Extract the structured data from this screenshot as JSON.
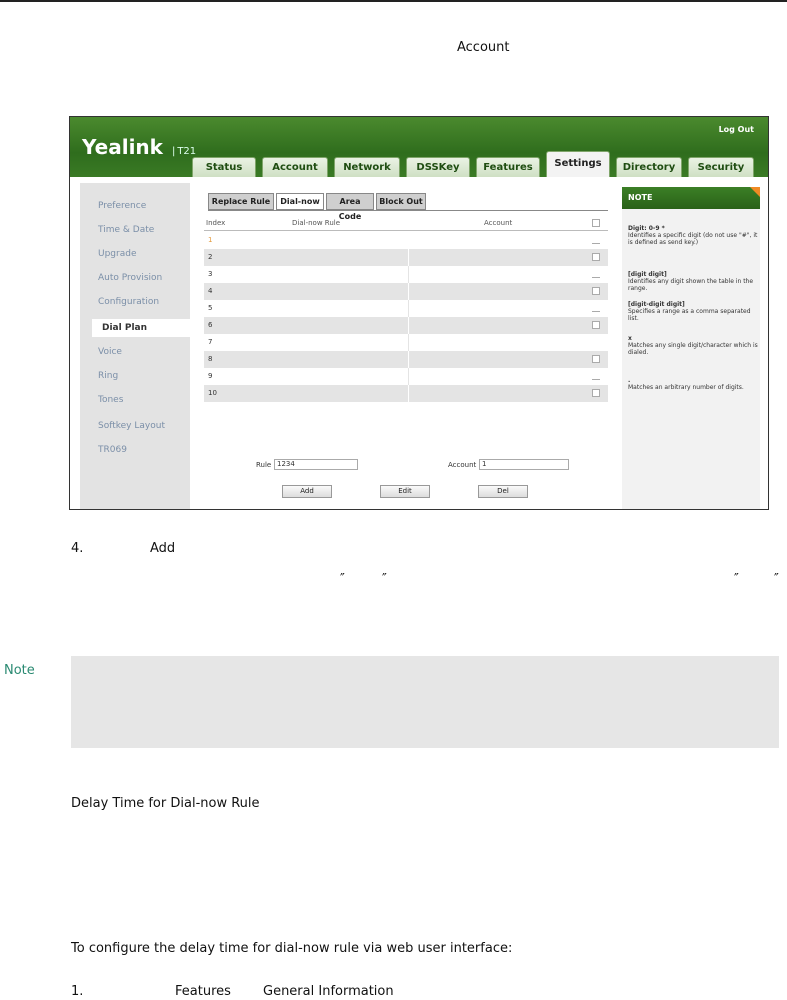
{
  "doc": {
    "account_label": "Account",
    "step4_number": "4.",
    "step4_word": "Add",
    "quote_mark": "″",
    "note_label": "Note",
    "section_heading": "Delay Time for Dial-now Rule",
    "procedure_heading": "To configure the delay time for dial-now rule via web user interface:",
    "step1_number": "1.",
    "step1_path1": "Features",
    "step1_path2": "General Information"
  },
  "webui": {
    "logo": "Yealink",
    "model": "T21",
    "logout": "Log Out",
    "nav_tabs": [
      "Status",
      "Account",
      "Network",
      "DSSKey",
      "Features",
      "Settings",
      "Directory",
      "Security"
    ],
    "active_nav": "Settings",
    "sidebar": [
      "Preference",
      "Time & Date",
      "Upgrade",
      "Auto Provision",
      "Configuration",
      "Dial Plan",
      "Voice",
      "Ring",
      "Tones",
      "Softkey Layout",
      "TR069"
    ],
    "active_sidebar": "Dial Plan",
    "subtabs": [
      "Replace Rule",
      "Dial-now",
      "Area Code",
      "Block Out"
    ],
    "active_subtab": "Dial-now",
    "table": {
      "col_index": "Index",
      "col_rule": "Dial-now Rule",
      "col_account": "Account",
      "rows": [
        "1",
        "2",
        "3",
        "4",
        "5",
        "6",
        "7",
        "8",
        "9",
        "10"
      ]
    },
    "form": {
      "rule_label": "Rule",
      "rule_value": "1234",
      "account_label": "Account",
      "account_value": "1"
    },
    "buttons": [
      "Add",
      "Edit",
      "Del"
    ],
    "note": {
      "title": "NOTE",
      "items": [
        {
          "head": "Digit: 0-9 *",
          "body": "Identifies a specific digit (do not use \"#\", it is defined as send key.)"
        },
        {
          "head": "[digit digit]",
          "body": "Identifies any digit shown the table in the range."
        },
        {
          "head": "[digit-digit digit]",
          "body": "Specifies a range as a comma separated list."
        },
        {
          "head": "x",
          "body": "Matches any single digit/character which is dialed."
        },
        {
          "head": ".",
          "body": "Matches an arbitrary number of digits."
        }
      ]
    }
  },
  "colors": {
    "header_green": "#2f6d1d",
    "note_accent": "#f08a24",
    "note_label": "#2a8a72",
    "note_box": "#e6e6e6"
  }
}
